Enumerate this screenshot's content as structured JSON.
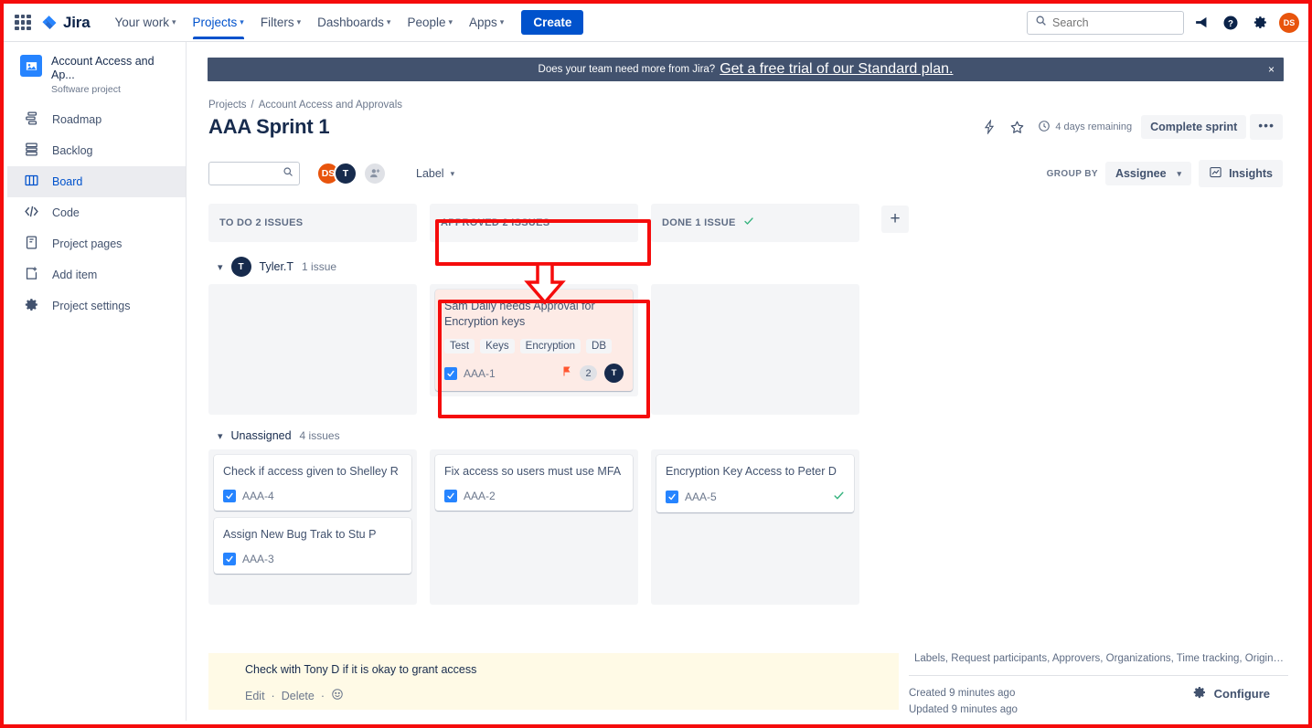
{
  "topnav": {
    "apps_icon": "apps-grid-icon",
    "brand": "Jira",
    "items": [
      {
        "label": "Your work",
        "active": false
      },
      {
        "label": "Projects",
        "active": true
      },
      {
        "label": "Filters",
        "active": false
      },
      {
        "label": "Dashboards",
        "active": false
      },
      {
        "label": "People",
        "active": false
      },
      {
        "label": "Apps",
        "active": false
      }
    ],
    "create_label": "Create",
    "search_placeholder": "Search",
    "search_value": "",
    "notifications_icon": "megaphone-icon",
    "help_icon": "help-circle-icon",
    "settings_icon": "gear-icon",
    "profile_initials": "DS",
    "profile_color": "#e8540c"
  },
  "sidebar": {
    "project_name": "Account Access and Ap...",
    "project_type": "Software project",
    "items": [
      {
        "label": "Roadmap",
        "icon": "roadmap-icon",
        "active": false
      },
      {
        "label": "Backlog",
        "icon": "backlog-icon",
        "active": false
      },
      {
        "label": "Board",
        "icon": "board-icon",
        "active": true
      },
      {
        "label": "Code",
        "icon": "code-icon",
        "active": false
      },
      {
        "label": "Project pages",
        "icon": "pages-icon",
        "active": false
      },
      {
        "label": "Add item",
        "icon": "add-item-icon",
        "active": false
      },
      {
        "label": "Project settings",
        "icon": "settings-gear-icon",
        "active": false
      }
    ]
  },
  "banner": {
    "text": "Does your team need more from Jira?",
    "link": "Get a free trial of our Standard plan.",
    "close": "×",
    "bg": "#42526e"
  },
  "header": {
    "breadcrumb_root": "Projects",
    "breadcrumb_sep": "/",
    "breadcrumb_current": "Account Access and Approvals",
    "title": "AAA Sprint 1",
    "lightning_icon": "lightning-bolt-icon",
    "star_icon": "star-icon",
    "clock_icon": "clock-icon",
    "days_remaining": "4 days remaining",
    "complete_sprint": "Complete sprint",
    "more_actions": "•••"
  },
  "toolbar": {
    "search_placeholder": "",
    "search_value": "",
    "search_icon": "search-icon",
    "avatars": [
      {
        "initials": "DS",
        "color": "#e8540c"
      },
      {
        "initials": "T",
        "color": "#172b4d"
      }
    ],
    "add_people_icon": "add-person-icon",
    "label_filter": "Label",
    "label_caret": "chevron-down-icon",
    "group_by_label": "GROUP BY",
    "group_by_value": "Assignee",
    "insights_label": "Insights",
    "insights_icon": "insights-chart-icon"
  },
  "board": {
    "columns": [
      {
        "title": "TO DO 2 ISSUES",
        "done": false
      },
      {
        "title": "APPROVED 2 ISSUES",
        "done": false,
        "highlighted": true
      },
      {
        "title": "DONE 1 ISSUE",
        "done": true
      }
    ],
    "add_column": "+",
    "swimlanes": [
      {
        "name": "Tyler.T",
        "avatar_initials": "T",
        "avatar_color": "#172b4d",
        "count": "1 issue",
        "cards": {
          "todo": [],
          "approved": [
            {
              "title": "Sam Daily needs Approval for Encryption keys",
              "labels": [
                "Test",
                "Keys",
                "Encryption",
                "DB"
              ],
              "key": "AAA-1",
              "flagged": true,
              "flag_icon": "flag-icon",
              "badge": "2",
              "assignee_initials": "T",
              "assignee_color": "#172b4d"
            }
          ],
          "done": []
        }
      },
      {
        "name": "Unassigned",
        "count": "4 issues",
        "cards": {
          "todo": [
            {
              "title": "Check if access given to Shelley R",
              "key": "AAA-4"
            },
            {
              "title": "Assign New Bug Trak to Stu P",
              "key": "AAA-3"
            }
          ],
          "approved": [
            {
              "title": "Fix access so users must use MFA",
              "key": "AAA-2"
            }
          ],
          "done": [
            {
              "title": "Encryption Key Access to Peter D",
              "key": "AAA-5",
              "done_check": "✓"
            }
          ]
        }
      }
    ]
  },
  "comment": {
    "text": "Check with Tony D if it is okay to grant access",
    "edit": "Edit",
    "sep1": "·",
    "delete": "Delete",
    "sep2": "·",
    "emoji_icon": "add-reaction-icon",
    "bg": "#fffae6"
  },
  "details": {
    "fields": "Labels, Request participants, Approvers, Organizations, Time tracking, Original est...",
    "created": "Created 9 minutes ago",
    "updated": "Updated 9 minutes ago",
    "configure": "Configure",
    "configure_icon": "gear-icon"
  },
  "annotation": {
    "color": "#f50c0c",
    "highlight_column": "APPROVED 2 ISSUES",
    "arrow": "down-arrow"
  }
}
